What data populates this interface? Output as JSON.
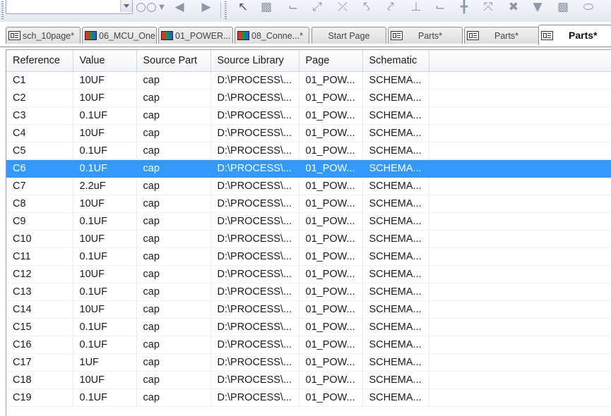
{
  "toolbar": {
    "combo_value": "",
    "icons": [
      "binoculars-icon",
      "back-icon",
      "forward-icon",
      "pointer-icon",
      "part-icon",
      "wire-icon",
      "bus-icon",
      "junction-icon",
      "bus-entry-icon",
      "net-alias-icon",
      "power-icon",
      "ground-icon",
      "offpage-icon",
      "hier-block-icon",
      "hier-port-icon",
      "no-connect-icon"
    ]
  },
  "tabs": [
    {
      "label": "sch_10page*",
      "icon": "schematic"
    },
    {
      "label": "06_MCU_One",
      "icon": "color"
    },
    {
      "label": "01_POWER...",
      "icon": "color"
    },
    {
      "label": "08_Conne...*",
      "icon": "color"
    },
    {
      "label": "Start Page",
      "icon": "none"
    },
    {
      "label": "Parts*",
      "icon": "schematic"
    },
    {
      "label": "Parts*",
      "icon": "schematic"
    },
    {
      "label": "Parts*",
      "icon": "schematic"
    }
  ],
  "grid": {
    "columns": [
      "Reference",
      "Value",
      "Source Part",
      "Source Library",
      "Page",
      "Schematic"
    ],
    "rows": [
      [
        "C1",
        "10UF",
        "cap",
        "D:\\PROCESS\\...",
        "01_POW...",
        "SCHEMA..."
      ],
      [
        "C2",
        "10UF",
        "cap",
        "D:\\PROCESS\\...",
        "01_POW...",
        "SCHEMA..."
      ],
      [
        "C3",
        "0.1UF",
        "cap",
        "D:\\PROCESS\\...",
        "01_POW...",
        "SCHEMA..."
      ],
      [
        "C4",
        "10UF",
        "cap",
        "D:\\PROCESS\\...",
        "01_POW...",
        "SCHEMA..."
      ],
      [
        "C5",
        "0.1UF",
        "cap",
        "D:\\PROCESS\\...",
        "01_POW...",
        "SCHEMA..."
      ],
      [
        "C6",
        "0.1UF",
        "cap",
        "D:\\PROCESS\\...",
        "01_POW...",
        "SCHEMA..."
      ],
      [
        "C7",
        "2.2uF",
        "cap",
        "D:\\PROCESS\\...",
        "01_POW...",
        "SCHEMA..."
      ],
      [
        "C8",
        "10UF",
        "cap",
        "D:\\PROCESS\\...",
        "01_POW...",
        "SCHEMA..."
      ],
      [
        "C9",
        "0.1UF",
        "cap",
        "D:\\PROCESS\\...",
        "01_POW...",
        "SCHEMA..."
      ],
      [
        "C10",
        "10UF",
        "cap",
        "D:\\PROCESS\\...",
        "01_POW...",
        "SCHEMA..."
      ],
      [
        "C11",
        "0.1UF",
        "cap",
        "D:\\PROCESS\\...",
        "01_POW...",
        "SCHEMA..."
      ],
      [
        "C12",
        "10UF",
        "cap",
        "D:\\PROCESS\\...",
        "01_POW...",
        "SCHEMA..."
      ],
      [
        "C13",
        "0.1UF",
        "cap",
        "D:\\PROCESS\\...",
        "01_POW...",
        "SCHEMA..."
      ],
      [
        "C14",
        "10UF",
        "cap",
        "D:\\PROCESS\\...",
        "01_POW...",
        "SCHEMA..."
      ],
      [
        "C15",
        "0.1UF",
        "cap",
        "D:\\PROCESS\\...",
        "01_POW...",
        "SCHEMA..."
      ],
      [
        "C16",
        "0.1UF",
        "cap",
        "D:\\PROCESS\\...",
        "01_POW...",
        "SCHEMA..."
      ],
      [
        "C17",
        "1UF",
        "cap",
        "D:\\PROCESS\\...",
        "01_POW...",
        "SCHEMA..."
      ],
      [
        "C18",
        "10UF",
        "cap",
        "D:\\PROCESS\\...",
        "01_POW...",
        "SCHEMA..."
      ],
      [
        "C19",
        "0.1UF",
        "cap",
        "D:\\PROCESS\\...",
        "01_POW...",
        "SCHEMA..."
      ]
    ],
    "selected_reference": "C6",
    "selection_color": "#3399ff"
  }
}
